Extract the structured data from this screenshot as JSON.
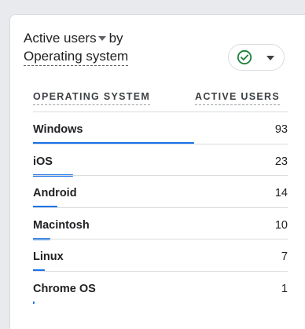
{
  "card": {
    "metric_label": "Active users",
    "by_label": "by",
    "dimension_label": "Operating system",
    "status_icon": "check-circle-icon",
    "accent_color": "#1a73e8",
    "status_color": "#188038"
  },
  "table": {
    "columns": [
      "OPERATING SYSTEM",
      "ACTIVE USERS"
    ],
    "rows": [
      {
        "label": "Windows",
        "value": "93",
        "share": 1.0
      },
      {
        "label": "iOS",
        "value": "23",
        "share": 0.247
      },
      {
        "label": "Android",
        "value": "14",
        "share": 0.151
      },
      {
        "label": "Macintosh",
        "value": "10",
        "share": 0.108
      },
      {
        "label": "Linux",
        "value": "7",
        "share": 0.075
      },
      {
        "label": "Chrome OS",
        "value": "1",
        "share": 0.011
      }
    ]
  }
}
